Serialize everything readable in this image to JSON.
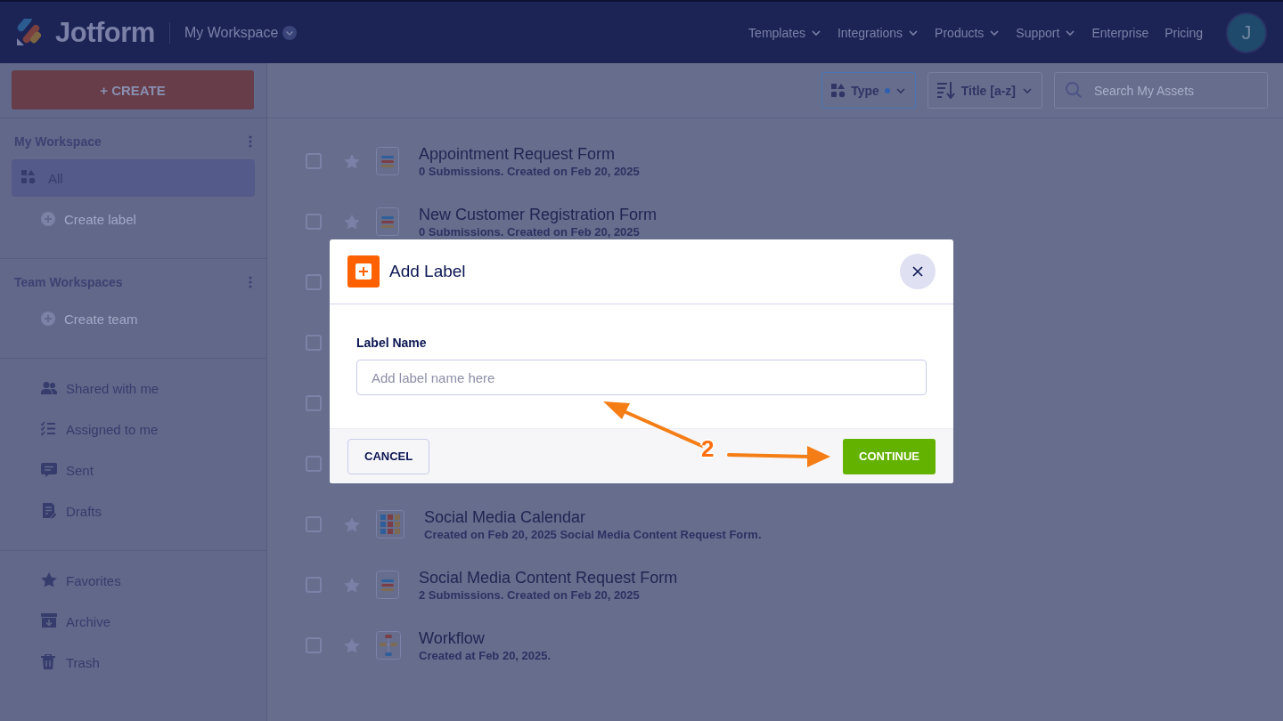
{
  "header": {
    "logo": "Jotform",
    "workspace": "My Workspace",
    "nav": [
      {
        "label": "Templates",
        "dropdown": true
      },
      {
        "label": "Integrations",
        "dropdown": true
      },
      {
        "label": "Products",
        "dropdown": true
      },
      {
        "label": "Support",
        "dropdown": true
      },
      {
        "label": "Enterprise",
        "dropdown": false
      },
      {
        "label": "Pricing",
        "dropdown": false
      }
    ],
    "avatar": "J"
  },
  "sidebar": {
    "create_button": "+ CREATE",
    "sections": [
      {
        "title": "My Workspace",
        "items": [
          {
            "kind": "nav",
            "label": "All",
            "selected": true
          },
          {
            "kind": "action",
            "label": "Create label"
          }
        ]
      },
      {
        "title": "Team Workspaces",
        "items": [
          {
            "kind": "action",
            "label": "Create team"
          }
        ]
      },
      {
        "items": [
          {
            "kind": "nav",
            "label": "Shared with me",
            "selected": false
          },
          {
            "kind": "nav",
            "label": "Assigned to me",
            "selected": false
          },
          {
            "kind": "nav",
            "label": "Sent",
            "selected": false
          },
          {
            "kind": "nav",
            "label": "Drafts",
            "selected": false
          }
        ]
      },
      {
        "items": [
          {
            "kind": "nav",
            "label": "Favorites",
            "selected": false
          },
          {
            "kind": "nav",
            "label": "Archive",
            "selected": false
          },
          {
            "kind": "nav",
            "label": "Trash",
            "selected": false
          }
        ]
      }
    ]
  },
  "toolbar": {
    "type_filter": "Type",
    "filter_active": true,
    "sort": "Title [a-z]",
    "search": {
      "placeholder": "Search My Assets"
    }
  },
  "assets": [
    {
      "kind": "form",
      "title": "Appointment Request Form",
      "subtitle": "0 Submissions. Created on Feb 20, 2025",
      "checked": false,
      "starred": false
    },
    {
      "kind": "form",
      "title": "New Customer Registration Form",
      "subtitle": "0 Submissions. Created on Feb 20, 2025",
      "checked": false,
      "starred": false
    },
    {
      "kind": "hidden",
      "checked": false
    },
    {
      "kind": "hidden",
      "checked": false
    },
    {
      "kind": "hidden",
      "checked": false
    },
    {
      "kind": "hidden",
      "checked": false
    },
    {
      "kind": "table",
      "title": "Social Media Calendar",
      "subtitle": "Created on Feb 20, 2025 Social Media Content Request Form.",
      "checked": false,
      "starred": false
    },
    {
      "kind": "form",
      "title": "Social Media Content Request Form",
      "subtitle": "2 Submissions. Created on Feb 20, 2025",
      "checked": false,
      "starred": false
    },
    {
      "kind": "workflow",
      "title": "Workflow",
      "subtitle": "Created at Feb 20, 2025.",
      "checked": false,
      "starred": false
    }
  ],
  "modal": {
    "title": "Add Label",
    "field_label": "Label Name",
    "placeholder": "Add label name here",
    "cancel": "CANCEL",
    "confirm": "CONTINUE"
  },
  "annotation": {
    "step": "2"
  }
}
